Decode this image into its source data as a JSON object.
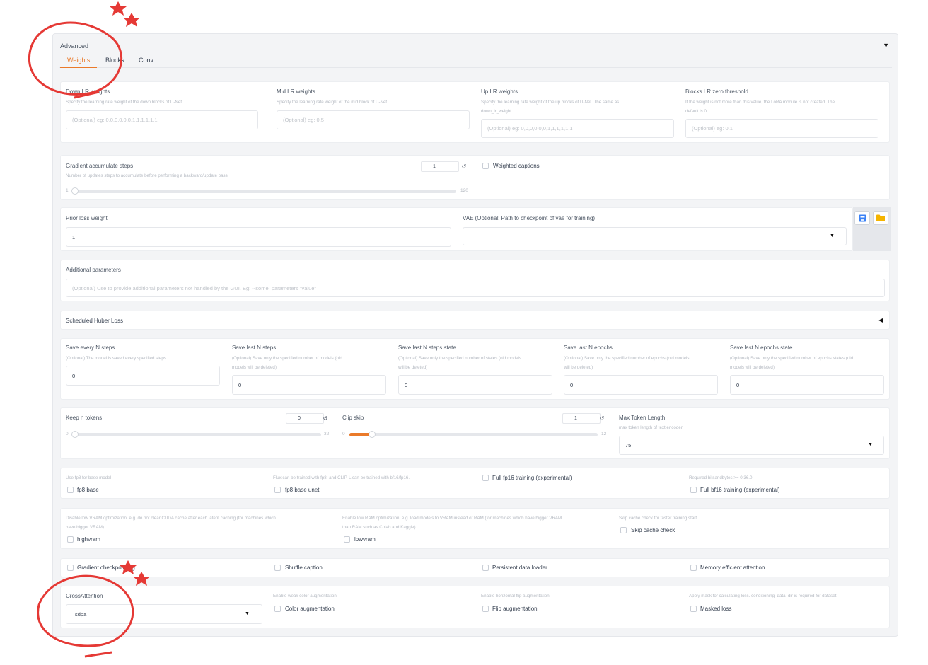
{
  "advanced": {
    "title": "Advanced",
    "tabs": [
      "Weights",
      "Blocks",
      "Conv"
    ],
    "active_tab": "Weights"
  },
  "weights": {
    "down": {
      "label": "Down LR weights",
      "desc": "Specify the learning rate weight of the down blocks of U-Net.",
      "placeholder": "(Optional) eg: 0,0,0,0,0,0,1,1,1,1,1,1"
    },
    "mid": {
      "label": "Mid LR weights",
      "desc": "Specify the learning rate weight of the mid block of U-Net.",
      "placeholder": "(Optional) eg: 0.5"
    },
    "up": {
      "label": "Up LR weights",
      "desc1": "Specify the learning rate weight of the up blocks of U-Net. The same as",
      "desc2": "down_lr_weight.",
      "placeholder": "(Optional) eg: 0,0,0,0,0,0,1,1,1,1,1,1"
    },
    "zero": {
      "label": "Blocks LR zero threshold",
      "desc1": "If the weight is not more than this value, the LoRA module is not created. The",
      "desc2": "default is 0.",
      "placeholder": "(Optional) eg: 0.1"
    }
  },
  "grad_accum": {
    "label": "Gradient accumulate steps",
    "desc": "Number of updates steps to accumulate before performing a backward/update pass",
    "value": "1",
    "min": "1",
    "max": "120",
    "level": 0.0
  },
  "weighted_captions": {
    "label": "Weighted captions",
    "checked": false
  },
  "prior_loss": {
    "label": "Prior loss weight",
    "value": "1"
  },
  "vae": {
    "label": "VAE (Optional: Path to checkpoint of vae for training)",
    "value": ""
  },
  "additional": {
    "label": "Additional parameters",
    "placeholder": "(Optional) Use to provide additional parameters not handled by the GUI. Eg: --some_parameters \"value\""
  },
  "huber": {
    "label": "Scheduled Huber Loss"
  },
  "save": {
    "every_steps": {
      "label": "Save every N steps",
      "desc1": "(Optional) The model is saved every specified steps",
      "desc2": "",
      "value": "0"
    },
    "last_steps": {
      "label": "Save last N steps",
      "desc1": "(Optional) Save only the specified number of models (old",
      "desc2": "models will be deleted)",
      "value": "0"
    },
    "last_steps_state": {
      "label": "Save last N steps state",
      "desc1": "(Optional) Save only the specified number of states (old models",
      "desc2": "will be deleted)",
      "value": "0"
    },
    "last_epochs": {
      "label": "Save last N epochs",
      "desc1": "(Optional) Save only the specified number of epochs (old models",
      "desc2": "will be deleted)",
      "value": "0"
    },
    "last_epochs_state": {
      "label": "Save last N epochs state",
      "desc1": "(Optional) Save only the specified number of epochs states (old",
      "desc2": "models will be deleted)",
      "value": "0"
    }
  },
  "keep_tokens": {
    "label": "Keep n tokens",
    "value": "0",
    "min": "0",
    "max": "32",
    "level": 0.0
  },
  "clip_skip": {
    "label": "Clip skip",
    "value": "1",
    "min": "0",
    "max": "12",
    "level": 0.083
  },
  "max_token": {
    "label": "Max Token Length",
    "desc": "max token length of text encoder",
    "value": "75"
  },
  "fp8": {
    "base": {
      "desc": "Use fp8 for base model",
      "label": "fp8 base"
    },
    "unet": {
      "desc": "Flux can be trained with fp8, and CLIP-L can be trained with bf16/fp16.",
      "label": "fp8 base unet"
    },
    "fp16": {
      "label": "Full fp16 training (experimental)"
    },
    "bf16": {
      "desc": "Required bitsandbytes >= 0.36.0",
      "label": "Full bf16 training (experimental)"
    }
  },
  "vram": {
    "high": {
      "desc1": "Disable low VRAM optimization. e.g. do not clear CUDA cache after each latent caching (for machines which",
      "desc2": "have bigger VRAM)",
      "label": "highvram"
    },
    "low": {
      "desc1": "Enable low RAM optimization. e.g. load models to VRAM instead of RAM (for machines which have bigger VRAM",
      "desc2": "than RAM such as Colab and Kaggle)",
      "label": "lowvram"
    },
    "skip": {
      "desc": "Skip cache check for faster training start",
      "label": "Skip cache check"
    }
  },
  "misc": {
    "grad_ckpt": "Gradient checkpointing",
    "shuffle": "Shuffle caption",
    "persistent": "Persistent data loader",
    "mem_eff": "Memory efficient attention"
  },
  "cross": {
    "label": "CrossAttention",
    "value": "sdpa",
    "color_desc": "Enable weak color augmentation",
    "color_label": "Color augmentation",
    "flip_desc": "Enable horizontal flip augmentation",
    "flip_label": "Flip augmentation",
    "mask_desc": "Apply mask for calculating loss. conditioning_data_dir is required for dataset",
    "mask_label": "Masked loss"
  },
  "colors": {
    "accent": "#ea7a2a",
    "annotation": "#e53935",
    "save_icon": "#3b82f6",
    "folder_icon": "#f5b400"
  },
  "icons": [
    "reset-icon",
    "chevron-down-icon",
    "collapse-icon",
    "save-icon",
    "folder-icon"
  ]
}
